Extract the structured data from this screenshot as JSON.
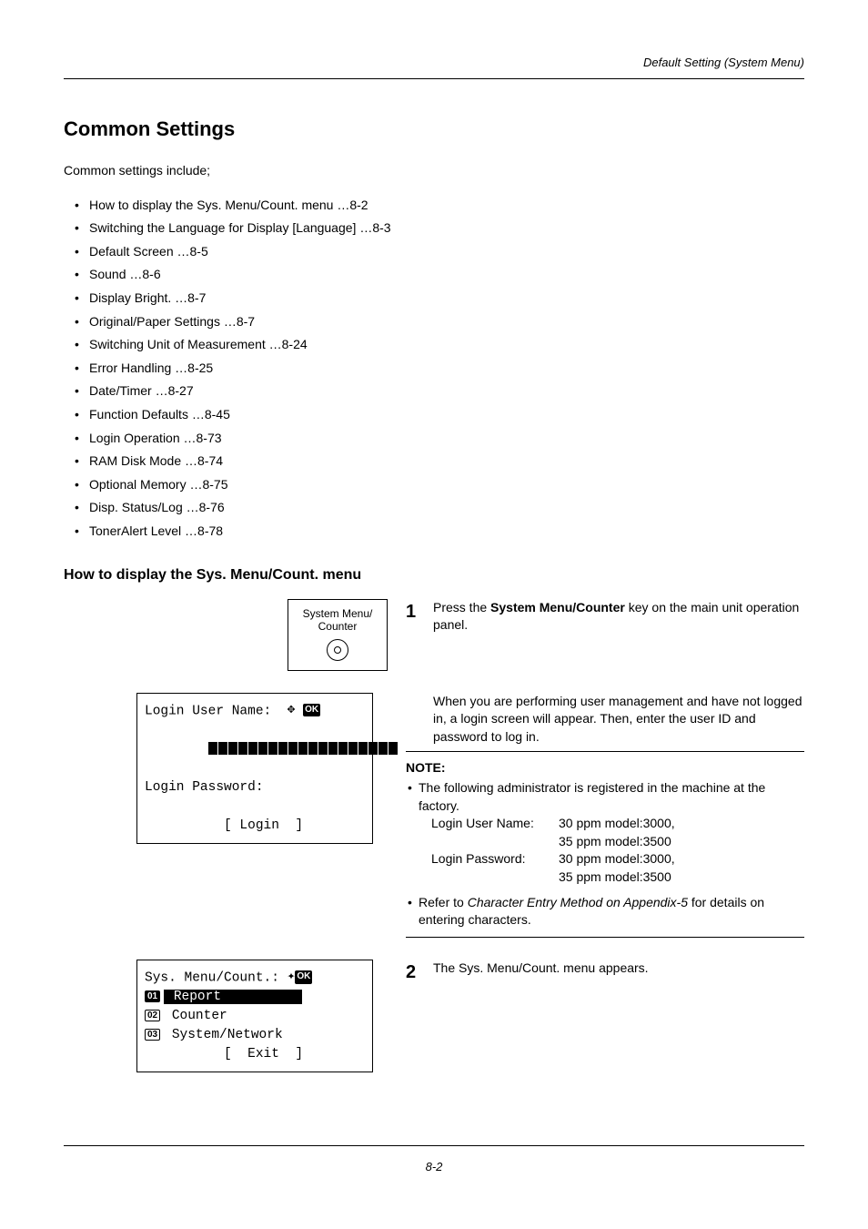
{
  "header": {
    "running_title": "Default Setting (System Menu)"
  },
  "title": "Common Settings",
  "intro": "Common settings include;",
  "toc": [
    "How to display the Sys. Menu/Count. menu …8-2",
    "Switching the Language for Display [Language] …8-3",
    "Default Screen …8-5",
    "Sound …8-6",
    "Display Bright. …8-7",
    "Original/Paper Settings …8-7",
    "Switching Unit of Measurement …8-24",
    "Error Handling …8-25",
    "Date/Timer …8-27",
    "Function Defaults …8-45",
    "Login Operation …8-73",
    "RAM Disk Mode …8-74",
    "Optional Memory …8-75",
    "Disp. Status/Log …8-76",
    "TonerAlert Level …8-78"
  ],
  "subheading": "How to display the Sys. Menu/Count. menu",
  "button_panel": {
    "line1": "System Menu/",
    "line2": "Counter"
  },
  "step1": {
    "num": "1",
    "prefix": "Press the ",
    "bold": "System Menu/Counter",
    "suffix": " key on the main unit operation panel."
  },
  "paragraph_login": "When you are performing user management and have not logged in, a login screen will appear. Then, enter the user ID and password to log in.",
  "lcd_login": {
    "line1": "Login User Name:",
    "line2_blank": "",
    "line3": "Login Password:",
    "line4": "          [ Login  ]"
  },
  "note": {
    "title": "NOTE:",
    "item1": "The following administrator is registered in the machine at the factory.",
    "rows": [
      {
        "label": "Login User Name:",
        "val": "30 ppm model:3000,"
      },
      {
        "label": "",
        "val": "35 ppm model:3500"
      },
      {
        "label": "Login Password:",
        "val": "30 ppm model:3000,"
      },
      {
        "label": "",
        "val": "35 ppm model:3500"
      }
    ],
    "item2_prefix": "Refer to ",
    "item2_italic": "Character Entry Method on Appendix-5",
    "item2_suffix": " for details on entering characters."
  },
  "step2": {
    "num": "2",
    "text": "The Sys. Menu/Count. menu appears."
  },
  "lcd_menu": {
    "title": "Sys. Menu/Count.:",
    "items": [
      {
        "num": "01",
        "label": " Report          ",
        "selected": true
      },
      {
        "num": "02",
        "label": " Counter",
        "selected": false
      },
      {
        "num": "03",
        "label": " System/Network",
        "selected": false
      }
    ],
    "footer": "          [  Exit  ]"
  },
  "page_number": "8-2"
}
